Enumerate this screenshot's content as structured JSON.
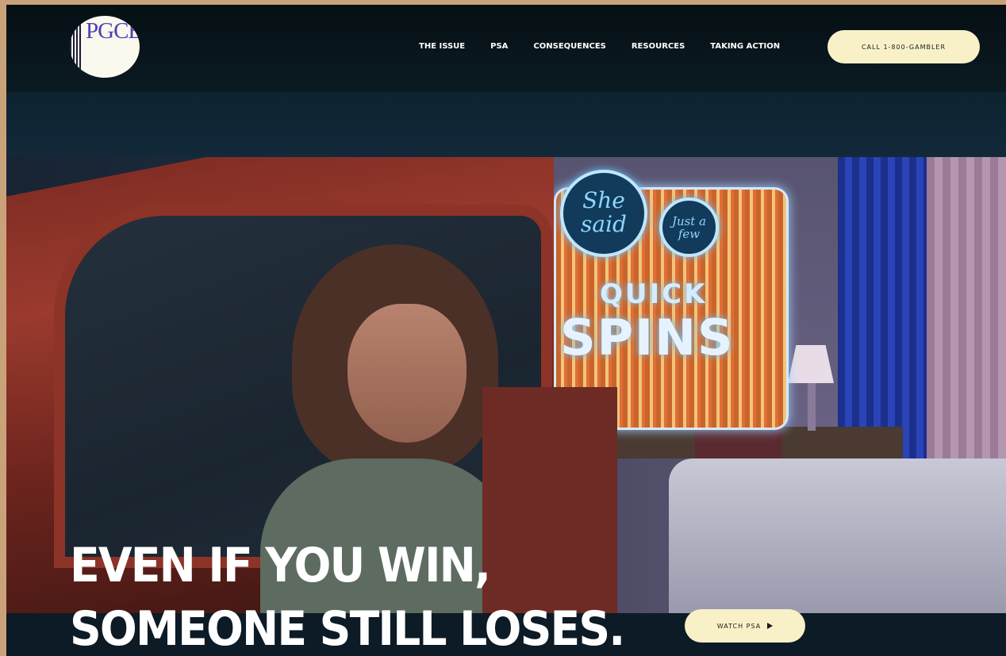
{
  "logo": {
    "text": "PGCB"
  },
  "nav": {
    "items": [
      "THE ISSUE",
      "PSA",
      "CONSEQUENCES",
      "RESOURCES",
      "TAKING ACTION"
    ]
  },
  "header": {
    "call_label": "CALL 1-800-GAMBLER"
  },
  "hero": {
    "sign_text_1": "She said",
    "sign_text_2": "Just a few",
    "sign_text_3": "QUICK",
    "sign_text_4": "SPINS",
    "headline_line1": "EVEN IF YOU WIN,",
    "headline_line2": "SOMEONE STILL LOSES.",
    "watch_label": "WATCH PSA"
  },
  "colors": {
    "button_bg": "#f8f1c8",
    "header_bg": "#061015",
    "logo_text": "#4d3fb7"
  }
}
